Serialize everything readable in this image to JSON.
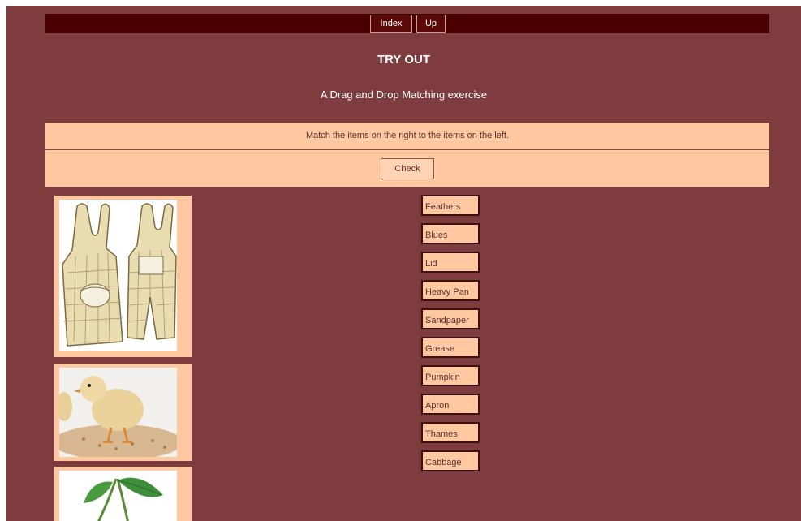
{
  "nav": {
    "home_label": "Index",
    "up_label": "Up"
  },
  "header": {
    "title": "TRY OUT",
    "subtitle": "A Drag and Drop Matching exercise"
  },
  "instructions": "Match the items on the right to the items on the left.",
  "check_label": "Check",
  "images": [
    {
      "icon": "apron-image"
    },
    {
      "icon": "chick-image"
    },
    {
      "icon": "cherries-image"
    }
  ],
  "cards": [
    {
      "label": "Feathers"
    },
    {
      "label": "Blues"
    },
    {
      "label": "Lid"
    },
    {
      "label": "Heavy Pan"
    },
    {
      "label": "Sandpaper"
    },
    {
      "label": "Grease"
    },
    {
      "label": "Pumpkin"
    },
    {
      "label": "Apron"
    },
    {
      "label": "Thames"
    },
    {
      "label": "Cabbage"
    }
  ],
  "colors": {
    "background": "#7e3c3f",
    "navbar": "#4a0000",
    "panel": "#ffc8a0"
  }
}
